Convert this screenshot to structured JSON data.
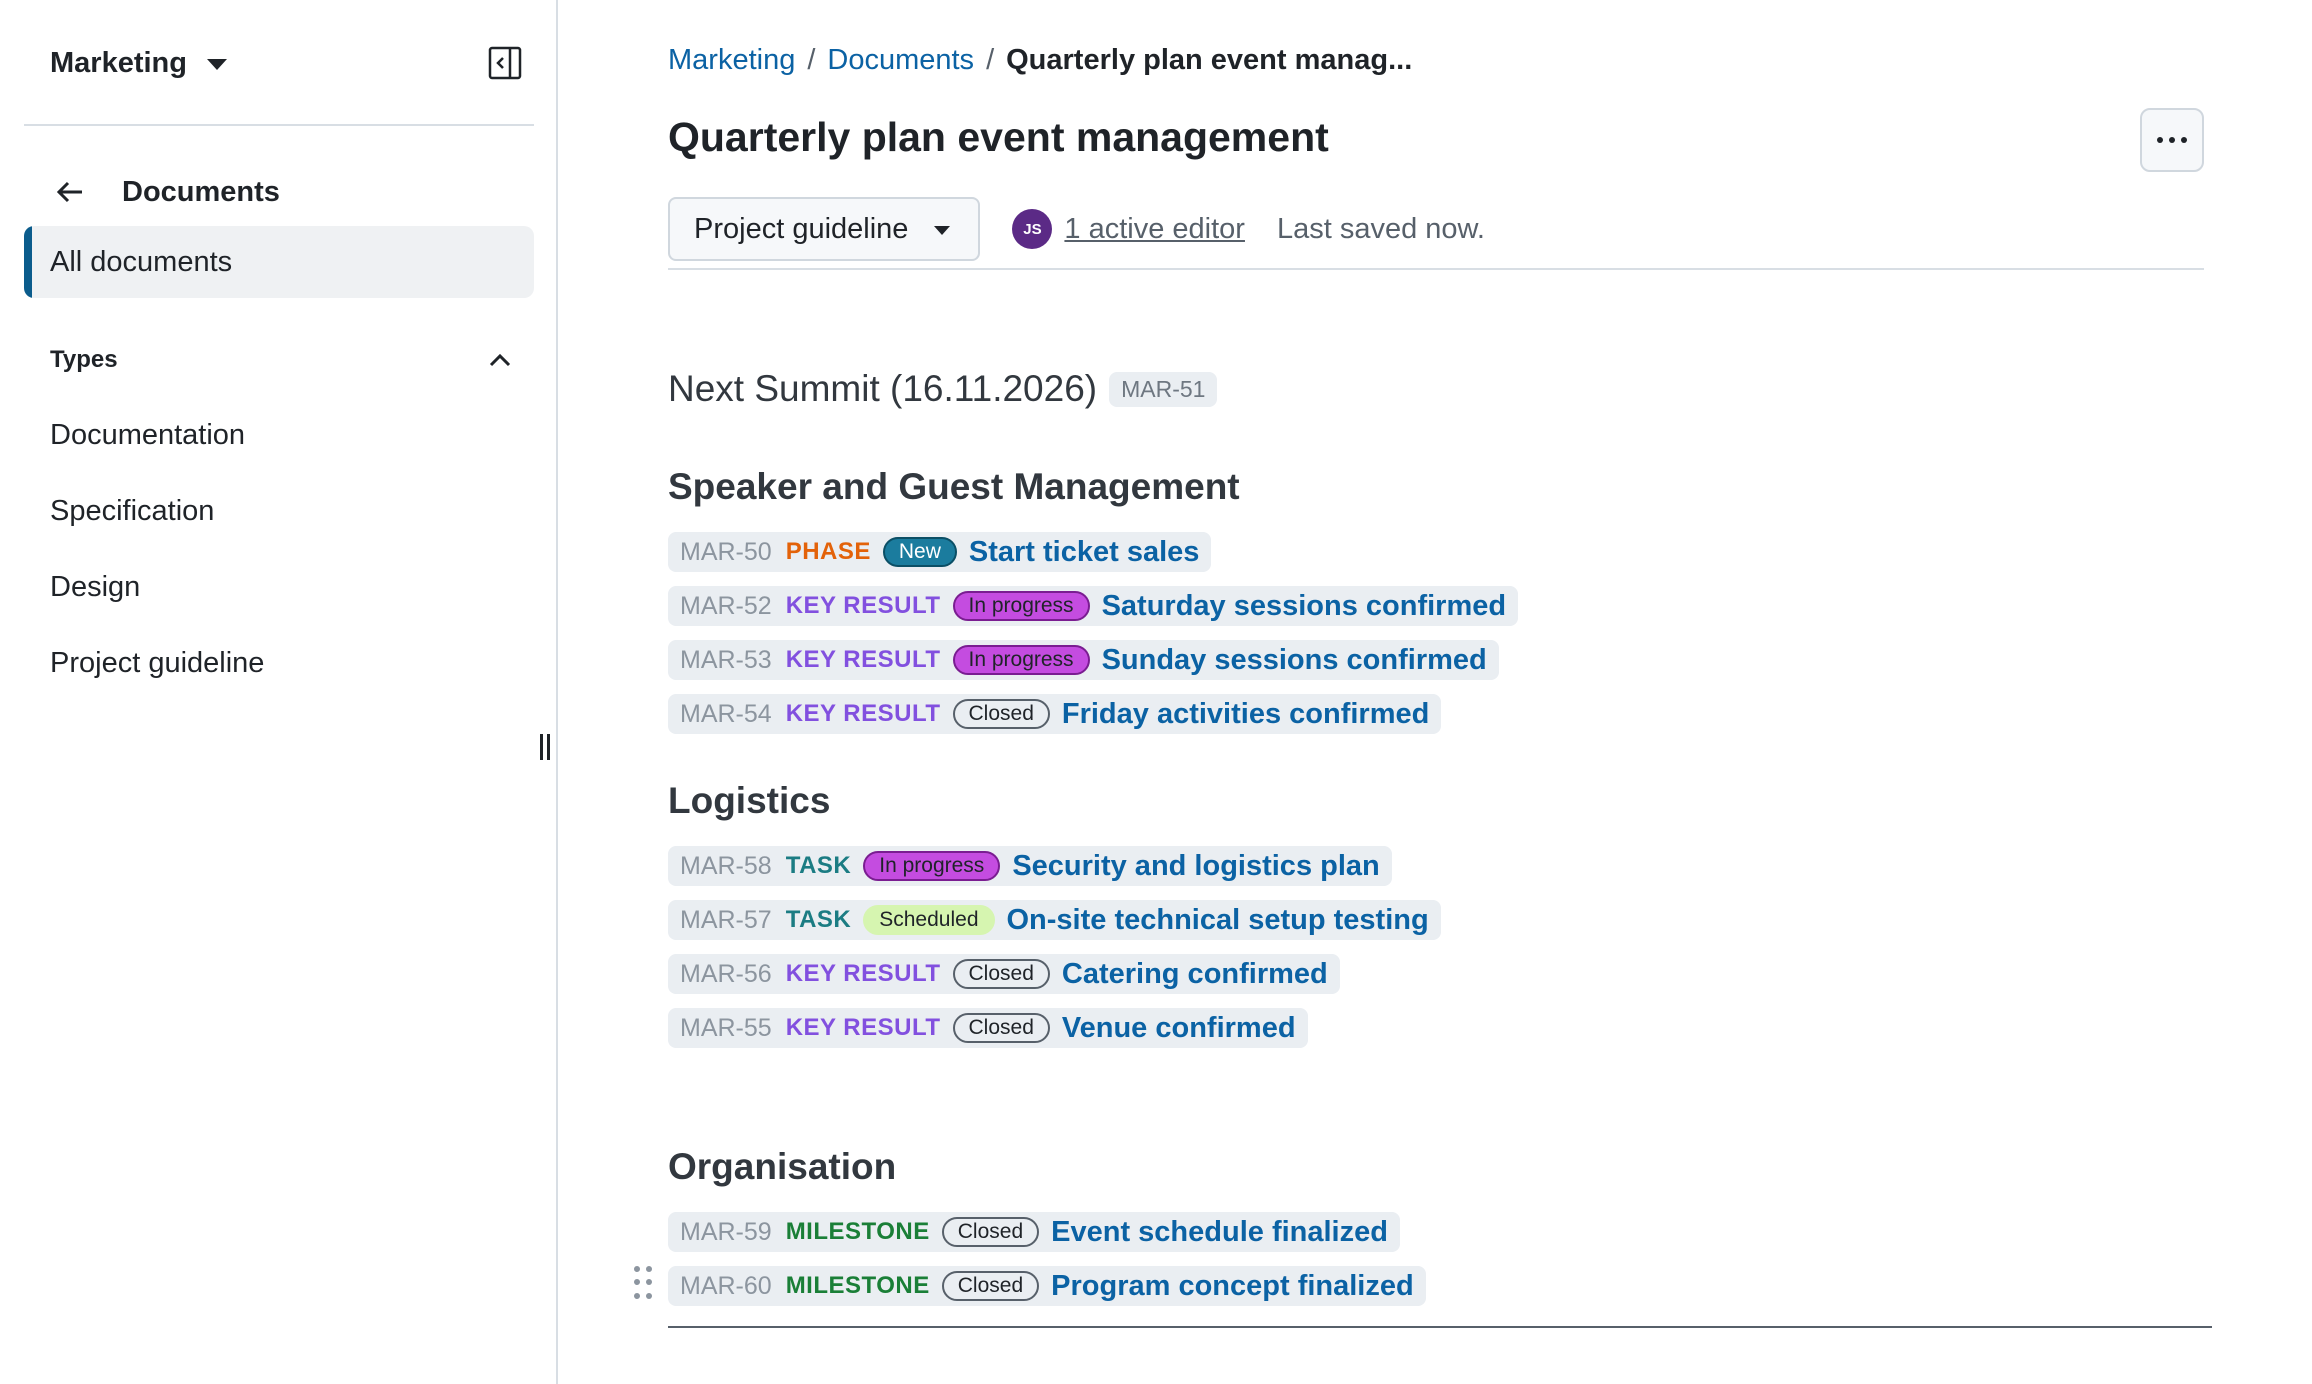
{
  "sidebar": {
    "project": "Marketing",
    "back_label": "Documents",
    "active_item": "All documents",
    "section_label": "Types",
    "types": [
      {
        "label": "Documentation"
      },
      {
        "label": "Specification"
      },
      {
        "label": "Design"
      },
      {
        "label": "Project guideline"
      }
    ],
    "icons": [
      "caret-down-icon",
      "collapse-sidebar-icon",
      "arrow-left-icon",
      "chevron-up-icon",
      "resize-handle-icon"
    ]
  },
  "header": {
    "breadcrumb": [
      "Marketing",
      "Documents",
      "Quarterly plan event manag..."
    ],
    "separator": "/",
    "title": "Quarterly plan event management",
    "more_icon": "ellipsis-icon"
  },
  "toolbar": {
    "type_select": "Project guideline",
    "editor_initials": "JS",
    "editor_link": "1 active editor",
    "saved_status": "Last saved now."
  },
  "document": {
    "heading": "Next Summit (16.11.2026)",
    "heading_id": "MAR-51",
    "sections": [
      {
        "title": "Speaker and Guest Management",
        "items": [
          {
            "id": "MAR-50",
            "type": "PHASE",
            "status": "New",
            "title": "Start ticket sales"
          },
          {
            "id": "MAR-52",
            "type": "KEY RESULT",
            "status": "In progress",
            "title": "Saturday sessions confirmed"
          },
          {
            "id": "MAR-53",
            "type": "KEY RESULT",
            "status": "In progress",
            "title": "Sunday sessions confirmed"
          },
          {
            "id": "MAR-54",
            "type": "KEY RESULT",
            "status": "Closed",
            "title": "Friday activities confirmed"
          }
        ]
      },
      {
        "title": "Logistics",
        "items": [
          {
            "id": "MAR-58",
            "type": "TASK",
            "status": "In progress",
            "title": "Security and logistics plan"
          },
          {
            "id": "MAR-57",
            "type": "TASK",
            "status": "Scheduled",
            "title": "On-site technical setup testing"
          },
          {
            "id": "MAR-56",
            "type": "KEY RESULT",
            "status": "Closed",
            "title": "Catering confirmed"
          },
          {
            "id": "MAR-55",
            "type": "KEY RESULT",
            "status": "Closed",
            "title": "Venue confirmed"
          }
        ]
      },
      {
        "title": "Organisation",
        "items": [
          {
            "id": "MAR-59",
            "type": "MILESTONE",
            "status": "Closed",
            "title": "Event schedule finalized"
          },
          {
            "id": "MAR-60",
            "type": "MILESTONE",
            "status": "Closed",
            "title": "Program concept finalized"
          }
        ]
      }
    ]
  },
  "colors": {
    "accent": "#0b5c8c",
    "link": "#0b62a4",
    "type_phase": "#e36209",
    "type_key_result": "#8250df",
    "type_task": "#1b7c83",
    "type_milestone": "#1a7f37",
    "status_new": "#1b7c9e",
    "status_in_progress": "#c44ce0",
    "status_scheduled": "#d6f5b0",
    "status_closed": "#eaeef2",
    "avatar": "#5b2a86"
  }
}
